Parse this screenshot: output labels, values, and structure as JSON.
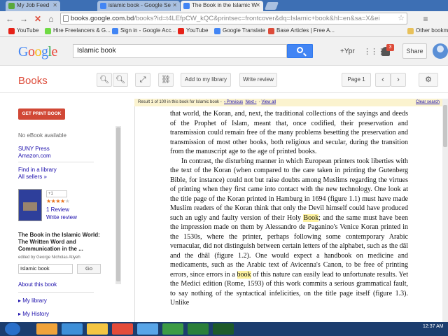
{
  "browser": {
    "tabs": [
      {
        "title": "My Job Feed",
        "active": false,
        "favicon_color": "#5aa93c"
      },
      {
        "title": "islamic book - Google Se",
        "active": false,
        "favicon_color": "#4285f4"
      },
      {
        "title": "The Book in the Islamic W",
        "active": true,
        "favicon_color": "#4285f4"
      }
    ],
    "url_main": "books.google.com.bd",
    "url_rest": "/books?id=t4LEfpCW_kQC&printsec=frontcover&dq=Islamic+book&hl=en&sa=X&ei",
    "bookmarks": [
      {
        "label": "YouTube",
        "icon_color": "#e62117"
      },
      {
        "label": "Hire Freelancers & G...",
        "icon_color": "#6fda44"
      },
      {
        "label": "Sign in - Google Acc...",
        "icon_color": "#4285f4"
      },
      {
        "label": "YouTube",
        "icon_color": "#e62117"
      },
      {
        "label": "Google Translate",
        "icon_color": "#4285f4"
      },
      {
        "label": "Base Articles | Free A...",
        "icon_color": "#dd4b39"
      },
      {
        "label": "Other bookmarks",
        "icon_color": "#e8c15a"
      }
    ]
  },
  "google_header": {
    "logo": [
      "G",
      "o",
      "o",
      "g",
      "l",
      "e"
    ],
    "logo_colors": [
      "#4285f4",
      "#ea4335",
      "#fbbc05",
      "#4285f4",
      "#34a853",
      "#ea4335"
    ],
    "search_value": "Islamic book",
    "plus_label": "+Ypr",
    "notification_count": "3",
    "share_label": "Share"
  },
  "books_bar": {
    "title": "Books",
    "add_to_library": "Add to my library",
    "write_review": "Write review",
    "page_label": "Page 1"
  },
  "sidebar": {
    "get_print": "GET PRINT BOOK",
    "no_ebook": "No eBook available",
    "sellers": [
      "SUNY Press",
      "Amazon.com"
    ],
    "find_library": "Find in a library",
    "all_sellers": "All sellers »",
    "gplus": "+1",
    "stars": "★★★★",
    "star_empty": "★",
    "reviews": "1 Review",
    "write_review": "Write review",
    "book_title": "The Book in the Islamic World: The Written Word and Communication in the ...",
    "edited_by": "edited by George Nicholas Atiyeh",
    "search_value": "Islamic book",
    "go_label": "Go",
    "about": "About this book",
    "my_library": "My library",
    "my_history": "My History"
  },
  "viewer": {
    "result_prefix": "Result 1 of 100 in this book for Islamic book -",
    "prev": "‹ Previous",
    "next": "Next ›",
    "view_all": "View all",
    "clear_search": "Clear search",
    "paragraph1": "that world, the Koran, and, next, the traditional collections of the sayings and deeds of the Prophet of Islam, meant that, once codified, their preservation and transmission could remain free of the many problems besetting the preservation and transmission of most other books, both religious and secular, during the transition from the manuscript age to the age of printed books.",
    "paragraph2_a": "In contrast, the disturbing manner in which European printers took liberties with the text of the Koran (when compared to the care taken in printing the Gutenberg Bible, for instance) could not but raise doubts among Muslims regarding the virtues of printing when they first came into contact with the new technology. One look at the title page of the Koran printed in Hamburg in 1694 (figure 1.1) must have made Muslim readers of the Koran think that only the Devil himself could have produced such an ugly and faulty version of their Holy ",
    "hl1": "Book",
    "paragraph2_b": "; and the same must have been the impression made on them by Alessandro de Paganino's Venice Koran printed in the 1530s, where the printer, perhaps following some contemporary Arabic vernacular, did not distinguish between certain letters of the alphabet, such as the dāl and the dhāl (figure 1.2). One would expect a handbook on medicine and medicaments, such as the Arabic text of Avicenna's Canon, to be free of printing errors, since errors in a ",
    "hl2": "book",
    "paragraph2_c": " of this nature can easily lead to unfortunate results. Yet the Medici edition (Rome, 1593) of this work commits a serious grammatical fault, to say nothing of the syntactical infelicities, on the title page itself (figure 1.3). Unlike"
  },
  "taskbar": {
    "time": "12:37 AM",
    "items_colors": [
      "#f0a33a",
      "#3e8fd8",
      "#f4c542",
      "#e34b3a",
      "#58a5e8",
      "#3c9b45",
      "#2a7f3a",
      "#1d5a2a"
    ]
  }
}
